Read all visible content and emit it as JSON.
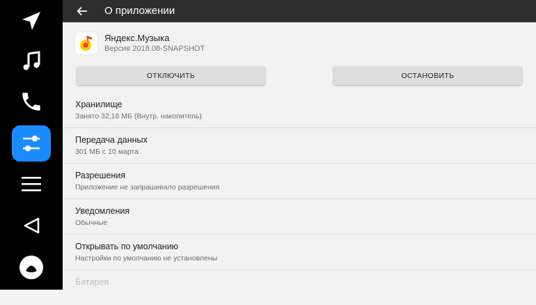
{
  "appbar": {
    "title": "О приложении"
  },
  "app": {
    "name": "Яндекс.Музыка",
    "version": "Версия 2018.08-SNAPSHOT"
  },
  "buttons": {
    "disable": "ОТКЛЮЧИТЬ",
    "stop": "ОСТАНОВИТЬ"
  },
  "rows": [
    {
      "title": "Хранилище",
      "subtitle": "Занято 32,18 МБ (Внутр. накопитель)"
    },
    {
      "title": "Передача данных",
      "subtitle": "301 МБ с 10 марта"
    },
    {
      "title": "Разрешения",
      "subtitle": "Приложение не запрашивало разрешения"
    },
    {
      "title": "Уведомления",
      "subtitle": "Обычные"
    },
    {
      "title": "Открывать по умолчанию",
      "subtitle": "Настройки по умолчанию не установлены"
    },
    {
      "title": "Батарея"
    }
  ],
  "nav": {
    "items": [
      "navigation-icon",
      "music-icon",
      "phone-icon",
      "settings-sliders-icon",
      "menu-icon",
      "back-triangle-icon",
      "alice-icon"
    ],
    "active": "settings-sliders-icon"
  },
  "colors": {
    "accent": "#1a8cff",
    "rail": "#000000",
    "appbar": "#2e2e2e",
    "background": "#f2f2f2"
  }
}
